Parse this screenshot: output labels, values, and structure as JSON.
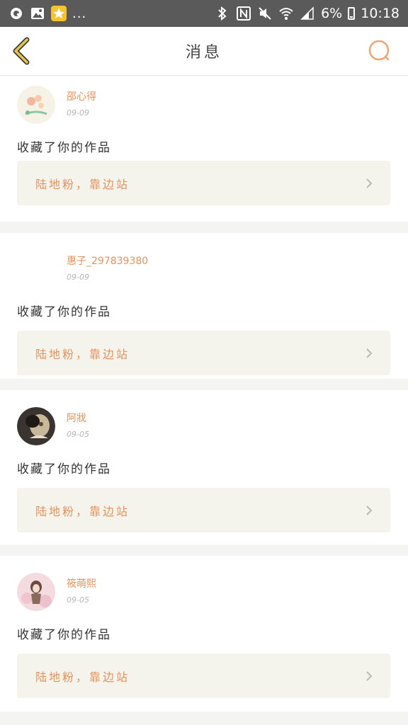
{
  "status_bar": {
    "left_icons": [
      "q-app-icon",
      "gallery-icon",
      "star-app-icon"
    ],
    "more": "...",
    "right_icons": [
      "bluetooth-icon",
      "nfc-icon",
      "mute-icon",
      "wifi-icon",
      "signal-icon",
      "battery-icon"
    ],
    "battery_percent": "6%",
    "time": "10:18"
  },
  "header": {
    "title": "消息",
    "accent_color": "#e8915a",
    "back_color": "#e6c64a"
  },
  "messages": [
    {
      "user": "邵心得",
      "date": "09-09",
      "text": "收藏了你的作品",
      "work": "陆地粉，靠边站",
      "avatar": "flower-avatar"
    },
    {
      "user": "惠子_297839380",
      "date": "09-09",
      "text": "收藏了你的作品",
      "work": "陆地粉，靠边站",
      "avatar": "none"
    },
    {
      "user": "阿戕",
      "date": "09-05",
      "text": "收藏了你的作品",
      "work": "陆地粉，靠边站",
      "avatar": "photo-avatar"
    },
    {
      "user": "筱萌熙",
      "date": "09-05",
      "text": "收藏了你的作品",
      "work": "陆地粉，靠边站",
      "avatar": "girl-avatar"
    }
  ]
}
